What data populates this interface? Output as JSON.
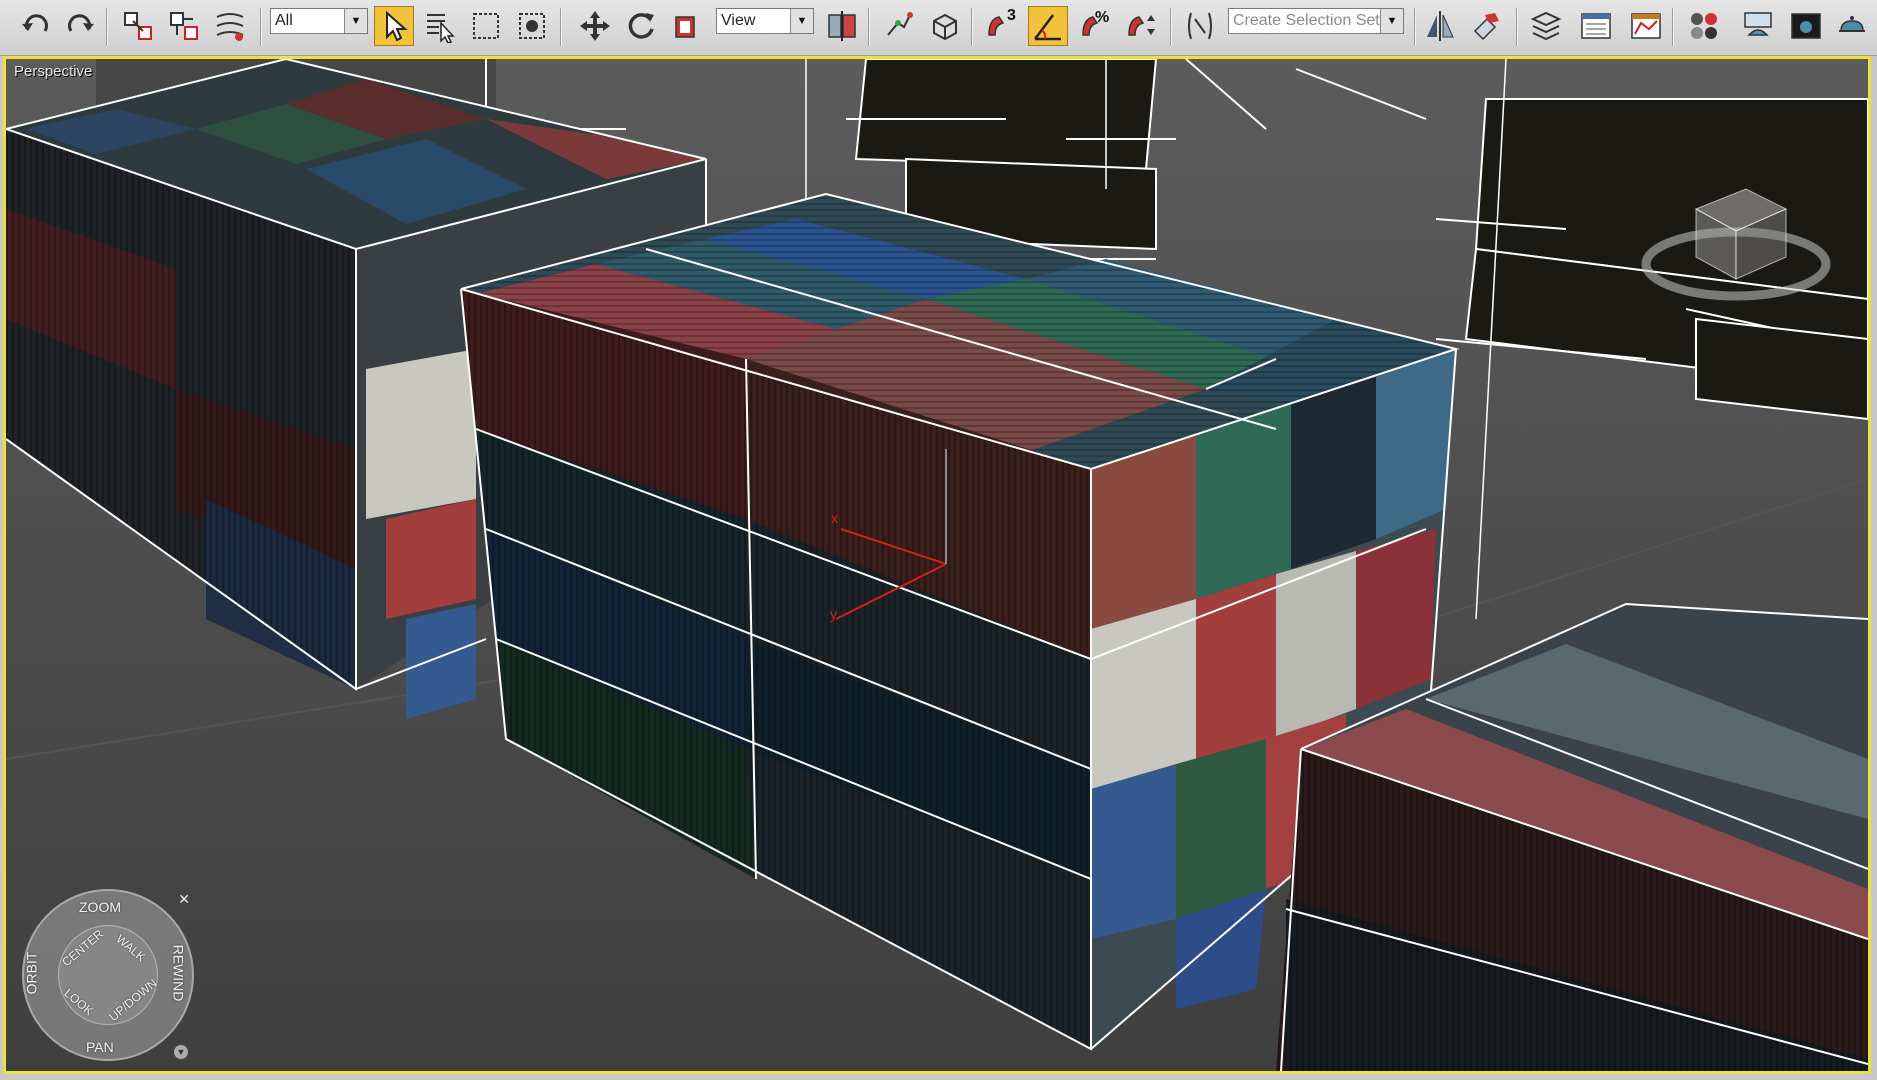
{
  "toolbar": {
    "selection_filter": "All",
    "reference_coord": "View",
    "named_selection_placeholder": "Create Selection Set",
    "snap_angle_label": "3",
    "percent_snap_label": "%",
    "active_tool": "select-object",
    "buttons": [
      {
        "name": "undo-icon"
      },
      {
        "name": "redo-icon"
      },
      {
        "name": "select-and-link-icon"
      },
      {
        "name": "unlink-selection-icon"
      },
      {
        "name": "bind-to-space-warp-icon"
      },
      {
        "name": "select-object-icon"
      },
      {
        "name": "select-by-name-icon"
      },
      {
        "name": "rectangular-selection-region-icon"
      },
      {
        "name": "window-crossing-icon"
      },
      {
        "name": "select-and-move-icon"
      },
      {
        "name": "select-and-rotate-icon"
      },
      {
        "name": "select-and-scale-icon"
      },
      {
        "name": "use-pivot-point-center-icon"
      },
      {
        "name": "select-and-manipulate-icon"
      },
      {
        "name": "keyboard-shortcut-override-icon"
      },
      {
        "name": "snaps-toggle-icon"
      },
      {
        "name": "angle-snap-toggle-icon"
      },
      {
        "name": "percent-snap-toggle-icon"
      },
      {
        "name": "spinner-snap-toggle-icon"
      },
      {
        "name": "edit-named-selection-sets-icon"
      },
      {
        "name": "mirror-icon"
      },
      {
        "name": "align-icon"
      },
      {
        "name": "layer-manager-icon"
      },
      {
        "name": "graphite-modeling-tools-icon"
      },
      {
        "name": "curve-editor-icon"
      },
      {
        "name": "material-editor-icon"
      },
      {
        "name": "render-setup-icon"
      },
      {
        "name": "rendered-frame-window-icon"
      },
      {
        "name": "render-production-icon"
      }
    ]
  },
  "viewport": {
    "label": "Perspective",
    "border_color": "#ece33a",
    "gizmo_x_label": "x",
    "gizmo_y_label": "y"
  },
  "steering_wheel": {
    "zoom": "ZOOM",
    "orbit": "ORBIT",
    "rewind": "REWIND",
    "pan": "PAN",
    "center": "CENTER",
    "walk": "WALK",
    "look": "LOOK",
    "updown": "UP/DOWN",
    "close_glyph": "✕"
  }
}
